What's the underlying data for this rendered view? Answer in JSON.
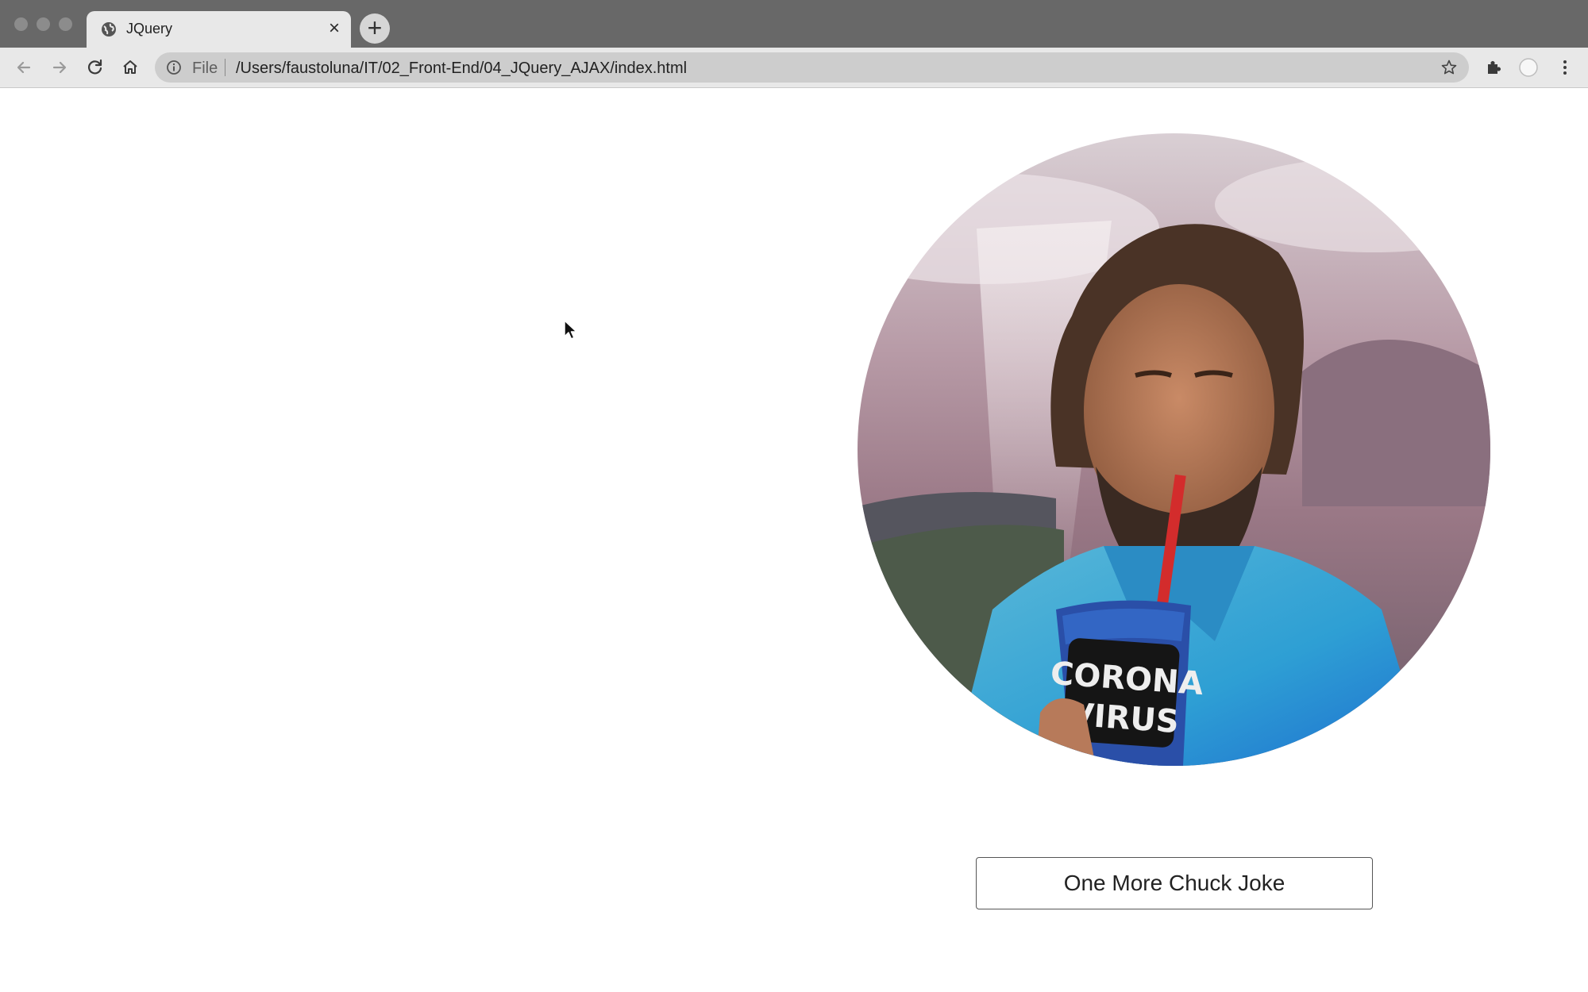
{
  "browser": {
    "tab_title": "JQuery",
    "new_tab_symbol": "+",
    "close_symbol": "×",
    "address": {
      "scheme_label": "File",
      "url": "/Users/faustoluna/IT/02_Front-End/04_JQuery_AJAX/index.html"
    },
    "icons": [
      "back-icon",
      "forward-icon",
      "reload-icon",
      "home-icon",
      "info-icon",
      "star-icon",
      "extensions-icon",
      "profile-icon",
      "menu-icon",
      "globe-icon"
    ]
  },
  "page": {
    "image_alt": "Chuck Norris drinking from a cup labeled CORONA VIRUS",
    "cup_text_line1": "CORONA",
    "cup_text_line2": "VIRUS",
    "button_label": "One More Chuck Joke"
  },
  "colors": {
    "titlebar": "#686868",
    "toolbar": "#e8e8e8",
    "omnibox": "#cdcdcd",
    "page_background": "#ffffff"
  }
}
